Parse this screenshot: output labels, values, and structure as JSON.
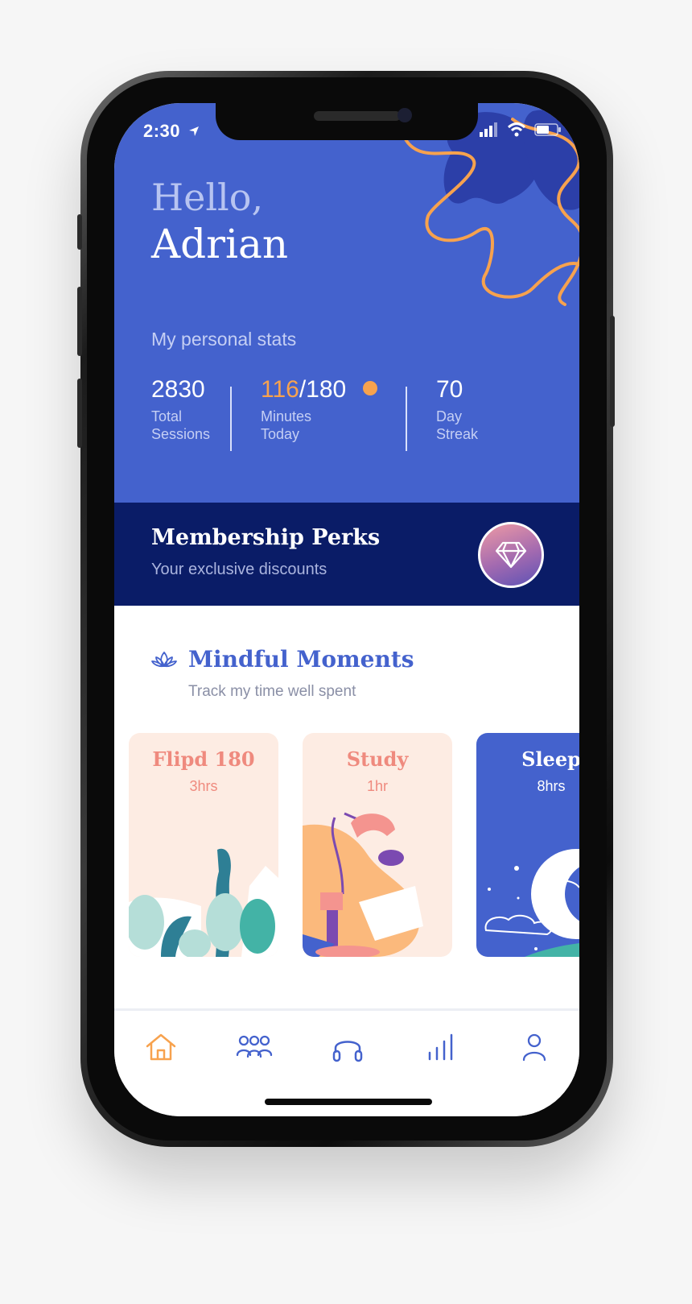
{
  "status_bar": {
    "time": "2:30"
  },
  "greeting": {
    "hello": "Hello,",
    "name": "Adrian"
  },
  "stats": {
    "label": "My personal stats",
    "sessions": {
      "value": "2830",
      "label_line1": "Total",
      "label_line2": "Sessions"
    },
    "minutes": {
      "current": "116",
      "goal": "/180",
      "label_line1": "Minutes",
      "label_line2": "Today"
    },
    "streak": {
      "value": "70",
      "label_line1": "Day",
      "label_line2": "Streak"
    }
  },
  "perks": {
    "title": "Membership Perks",
    "subtitle": "Your exclusive discounts",
    "icon": "diamond-icon"
  },
  "mindful": {
    "title": "Mindful Moments",
    "subtitle": "Track my time well spent",
    "icon": "lotus-icon",
    "cards": [
      {
        "title": "Flipd 180",
        "duration": "3hrs",
        "icon": "plants-illustration"
      },
      {
        "title": "Study",
        "duration": "1hr",
        "icon": "desk-lamp-illustration"
      },
      {
        "title": "Sleep",
        "duration": "8hrs",
        "icon": "moon-clouds-illustration"
      }
    ]
  },
  "tabbar": {
    "active": "home",
    "tabs": [
      "home-icon",
      "community-icon",
      "headphones-icon",
      "stats-icon",
      "profile-icon"
    ]
  },
  "colors": {
    "primary": "#4462cd",
    "navy": "#0a1c67",
    "accent_orange": "#f7a24e",
    "card_peach": "#fdece3",
    "card_coral_text": "#ef8a7e"
  }
}
